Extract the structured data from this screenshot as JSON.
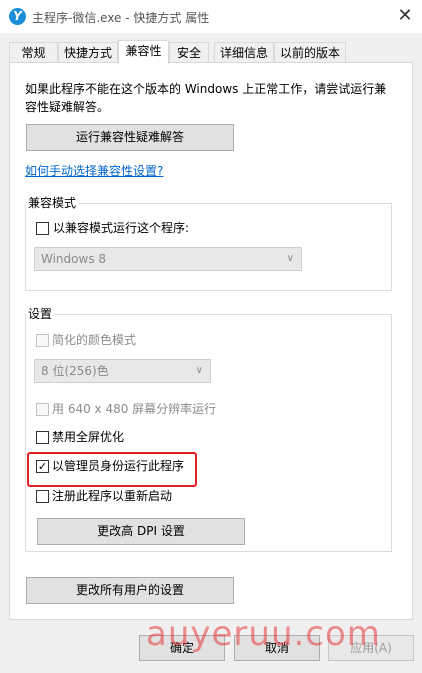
{
  "window": {
    "title": "主程序-微信.exe - 快捷方式 属性",
    "close_glyph": "✕",
    "app_icon_glyph": "Y"
  },
  "tabs": [
    {
      "label": "常规"
    },
    {
      "label": "快捷方式"
    },
    {
      "label": "兼容性",
      "active": true
    },
    {
      "label": "安全"
    },
    {
      "label": "详细信息"
    },
    {
      "label": "以前的版本"
    }
  ],
  "compat": {
    "intro_line1": "如果此程序不能在这个版本的 Windows 上正常工作，请尝试运行兼",
    "intro_line2": "容性疑难解答。",
    "troubleshooter_button": "运行兼容性疑难解答",
    "manual_link": "如何手动选择兼容性设置?",
    "mode_group": {
      "label": "兼容模式",
      "checkbox_label": "以兼容模式运行这个程序:",
      "checked": false,
      "os_select": "Windows 8"
    },
    "settings_group": {
      "label": "设置",
      "reduced_color": {
        "label": "简化的颜色模式",
        "checked": false,
        "enabled": false
      },
      "color_select": "8 位(256)色",
      "resolution": {
        "label": "用 640 x 480 屏幕分辨率运行",
        "checked": false,
        "enabled": false
      },
      "disable_fullscreen": {
        "label": "禁用全屏优化",
        "checked": false,
        "enabled": true
      },
      "run_as_admin": {
        "label": "以管理员身份运行此程序",
        "checked": true,
        "enabled": true
      },
      "register_restart": {
        "label": "注册此程序以重新启动",
        "checked": false,
        "enabled": true
      },
      "dpi_button": "更改高 DPI 设置"
    },
    "all_users_button": "更改所有用户的设置"
  },
  "footer": {
    "ok_button": "确定",
    "cancel_button": "取消",
    "apply_button": "应用(A)",
    "apply_enabled": false
  },
  "watermark": {
    "text": "auyeruu.com"
  },
  "colors": {
    "highlight": "#e02020",
    "link": "#0066cc",
    "watermark": "#e83838"
  }
}
